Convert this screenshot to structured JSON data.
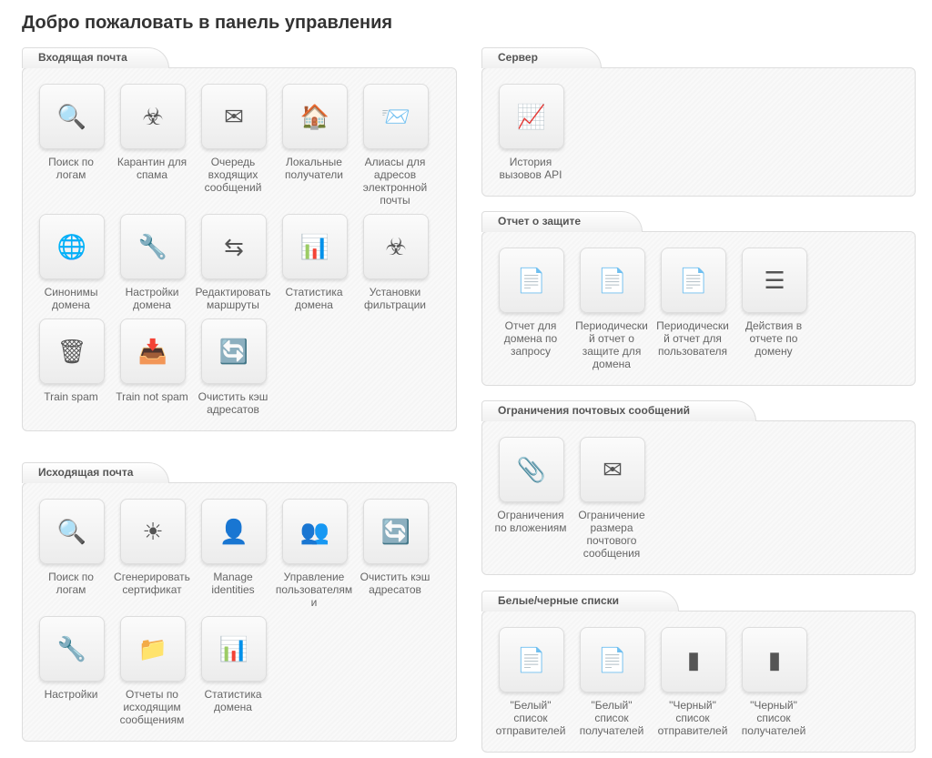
{
  "page_title": "Добро пожаловать в панель управления",
  "panels": {
    "incoming": {
      "title": "Входящая почта",
      "items": [
        {
          "label": "Поиск по\nлогам",
          "icon": "🔍"
        },
        {
          "label": "Карантин для\nспама",
          "icon": "☣"
        },
        {
          "label": "Очередь\nвходящих\nсообщений",
          "icon": "✉"
        },
        {
          "label": "Локальные\nполучатели",
          "icon": "🏠"
        },
        {
          "label": "Алиасы для\nадресов\nэлектронной\nпочты",
          "icon": "📨"
        },
        {
          "label": "Синонимы\nдомена",
          "icon": "🌐"
        },
        {
          "label": "Настройки\nдомена",
          "icon": "🔧"
        },
        {
          "label": "Редактировать\nмаршруты",
          "icon": "⇆"
        },
        {
          "label": "Статистика\nдомена",
          "icon": "📊"
        },
        {
          "label": "Установки\nфильтрации",
          "icon": "☣"
        },
        {
          "label": "Train spam",
          "icon": "🗑"
        },
        {
          "label": "Train not spam",
          "icon": "📥"
        },
        {
          "label": "Очистить кэш\nадресатов",
          "icon": "🔄"
        }
      ]
    },
    "outgoing": {
      "title": "Исходящая почта",
      "items": [
        {
          "label": "Поиск по\nлогам",
          "icon": "🔍"
        },
        {
          "label": "Сгенерировать\nсертификат",
          "icon": "☀"
        },
        {
          "label": "Manage\nidentities",
          "icon": "👤"
        },
        {
          "label": "Управление\nпользователям\nи",
          "icon": "👥"
        },
        {
          "label": "Очистить кэш\nадресатов",
          "icon": "🔄"
        },
        {
          "label": "Настройки",
          "icon": "🔧"
        },
        {
          "label": "Отчеты по\nисходящим\nсообщениям",
          "icon": "📁"
        },
        {
          "label": "Статистика\nдомена",
          "icon": "📊"
        }
      ]
    },
    "server": {
      "title": "Сервер",
      "items": [
        {
          "label": "История\nвызовов API",
          "icon": "📈"
        }
      ]
    },
    "protection": {
      "title": "Отчет о защите",
      "items": [
        {
          "label": "Отчет для\nдомена по\nзапросу",
          "icon": "📄"
        },
        {
          "label": "Периодически\nй отчет о\nзащите для\nдомена",
          "icon": "📄"
        },
        {
          "label": "Периодически\nй отчет для\nпользователя",
          "icon": "📄"
        },
        {
          "label": "Действия в\nотчете по\nдомену",
          "icon": "☰"
        }
      ]
    },
    "limits": {
      "title": "Ограничения почтовых сообщений",
      "items": [
        {
          "label": "Ограничения\nпо вложениям",
          "icon": "📎"
        },
        {
          "label": "Ограничение\nразмера\nпочтового\nсообщения",
          "icon": "✉"
        }
      ]
    },
    "lists": {
      "title": "Белые/черные списки",
      "items": [
        {
          "label": "\"Белый\"\nсписок\nотправителей",
          "icon": "📄"
        },
        {
          "label": "\"Белый\"\nсписок\nполучателей",
          "icon": "📄"
        },
        {
          "label": "\"Черный\"\nсписок\nотправителей",
          "icon": "▮"
        },
        {
          "label": "\"Черный\"\nсписок\nполучателей",
          "icon": "▮"
        }
      ]
    }
  }
}
